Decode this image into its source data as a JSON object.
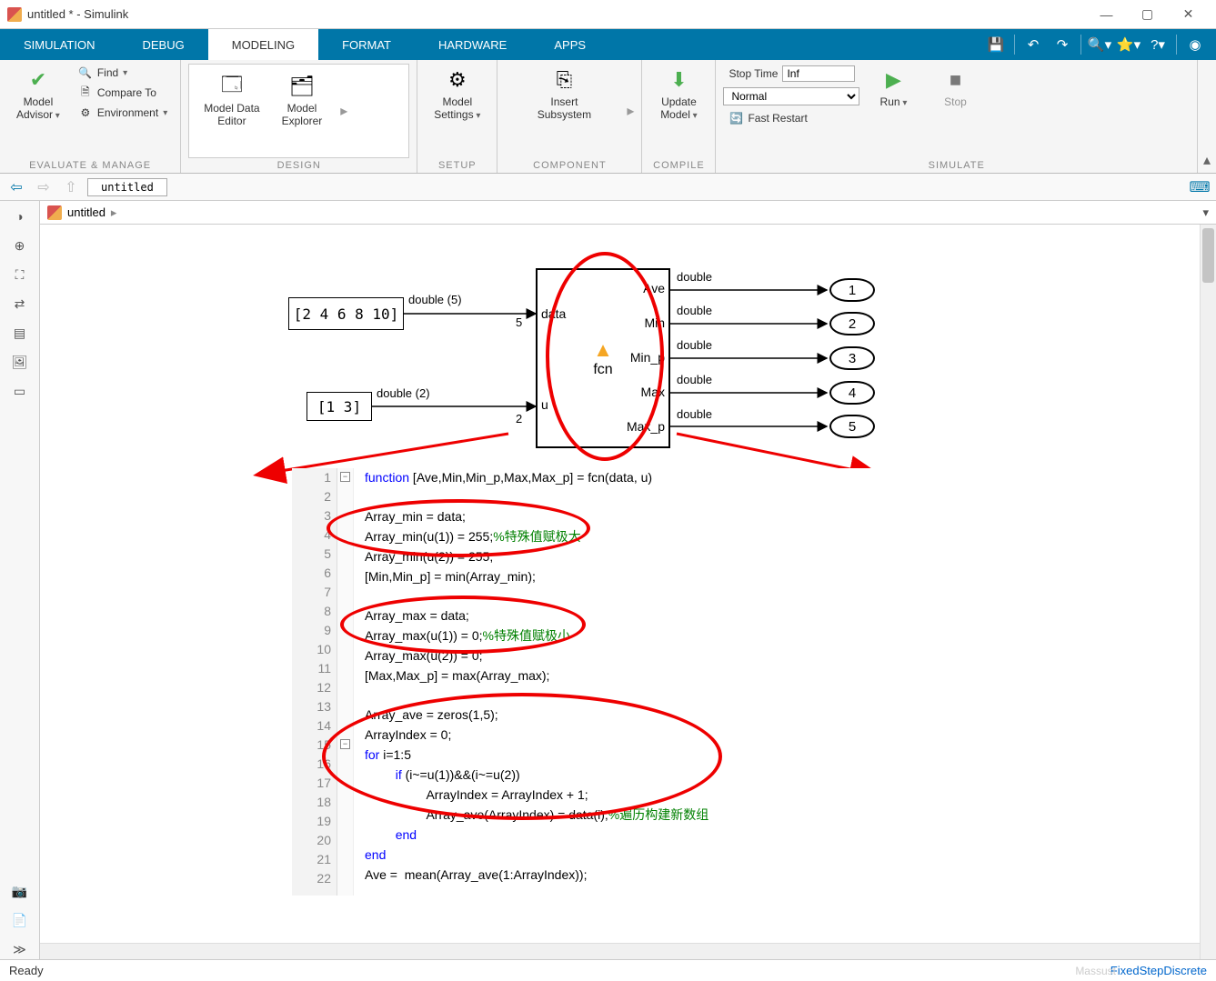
{
  "window": {
    "title": "untitled * - Simulink"
  },
  "tabs": [
    "SIMULATION",
    "DEBUG",
    "MODELING",
    "FORMAT",
    "HARDWARE",
    "APPS"
  ],
  "active_tab": 2,
  "toolstrip": {
    "eval_manage": {
      "label": "EVALUATE & MANAGE",
      "model_advisor": "Model\nAdvisor",
      "find": "Find",
      "compare": "Compare To",
      "environment": "Environment"
    },
    "design": {
      "label": "DESIGN",
      "model_data_editor": "Model Data\nEditor",
      "model_explorer": "Model\nExplorer"
    },
    "setup": {
      "label": "SETUP",
      "model_settings": "Model\nSettings"
    },
    "component": {
      "label": "COMPONENT",
      "insert_subsystem": "Insert\nSubsystem"
    },
    "compile": {
      "label": "COMPILE",
      "update_model": "Update\nModel"
    },
    "simulate": {
      "label": "SIMULATE",
      "stop_time_label": "Stop Time",
      "stop_time_value": "Inf",
      "mode": "Normal",
      "fast_restart": "Fast Restart",
      "run": "Run",
      "stop": "Stop"
    }
  },
  "nav": {
    "tab": "untitled"
  },
  "breadcrumb": {
    "model": "untitled"
  },
  "diagram": {
    "const1": {
      "text": "[2 4 6 8 10]",
      "sig": "double (5)",
      "dim": "5"
    },
    "const2": {
      "text": "[1 3]",
      "sig": "double (2)",
      "dim": "2"
    },
    "fcn": {
      "name": "fcn",
      "in1": "data",
      "in2": "u",
      "out1": "Ave",
      "out2": "Min",
      "out3": "Min_p",
      "out4": "Max",
      "out5": "Max_p"
    },
    "out_sig": "double",
    "outports": [
      "1",
      "2",
      "3",
      "4",
      "5"
    ]
  },
  "code": {
    "lines": {
      "l1_a": "function",
      "l1_b": " [Ave,Min,Min_p,Max,Max_p] = fcn(data, u)",
      "l3": "Array_min = data;",
      "l4_a": "Array_min(u(1)) = 255;",
      "l4_b": "%特殊值赋极大",
      "l5": "Array_min(u(2)) = 255;",
      "l6": "[Min,Min_p] = min(Array_min);",
      "l8": "Array_max = data;",
      "l9_a": "Array_max(u(1)) = 0;",
      "l9_b": "%特殊值赋极小",
      "l10": "Array_max(u(2)) = 0;",
      "l11": "[Max,Max_p] = max(Array_max);",
      "l13": "Array_ave = zeros(1,5);",
      "l14": "ArrayIndex = 0;",
      "l15_a": "for",
      "l15_b": " i=1:5",
      "l16_a": "if",
      "l16_b": " (i~=u(1))&&(i~=u(2))",
      "l17": "ArrayIndex = ArrayIndex + 1;",
      "l18_a": "Array_ave(ArrayIndex) = data(i);",
      "l18_b": "%遍历构建新数组",
      "l19": "end",
      "l20": "end",
      "l21": "Ave =  mean(Array_ave(1:ArrayIndex));"
    },
    "line_numbers": [
      "1",
      "2",
      "3",
      "4",
      "5",
      "6",
      "7",
      "8",
      "9",
      "10",
      "11",
      "12",
      "13",
      "14",
      "15",
      "16",
      "17",
      "18",
      "19",
      "20",
      "21",
      "22"
    ]
  },
  "status": {
    "left": "Ready",
    "right": "FixedStepDiscrete"
  },
  "watermark": "Massust"
}
